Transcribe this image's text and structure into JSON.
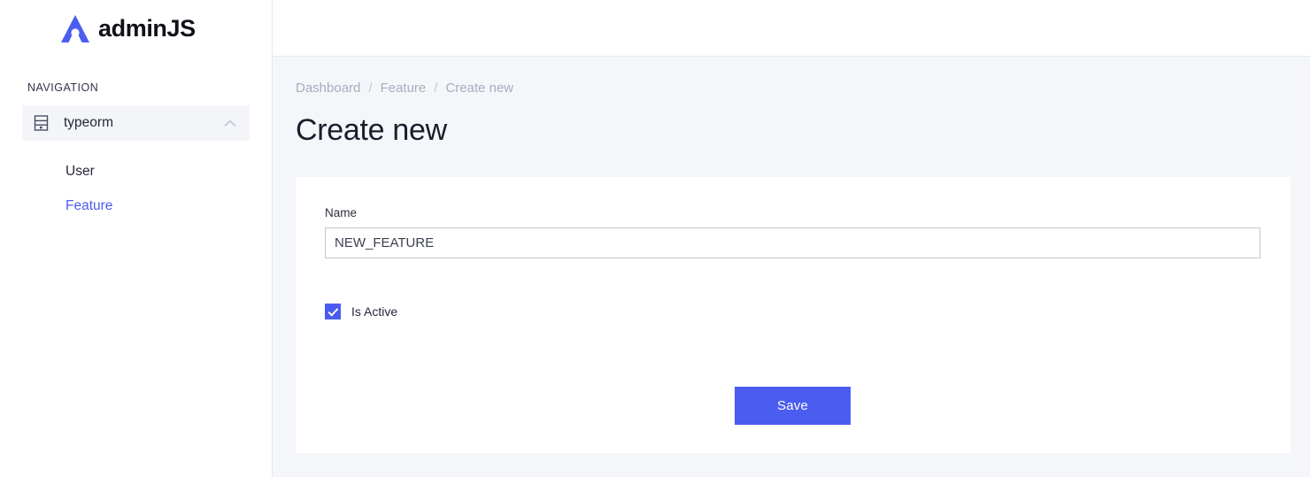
{
  "brand": {
    "logo_icon": "adminjs-a-logo-icon",
    "name": "adminJS",
    "accent_color": "#4b5cf0"
  },
  "sidebar": {
    "nav_title": "NAVIGATION",
    "group": {
      "label": "typeorm",
      "icon": "database-icon",
      "toggle_icon": "chevron-up-icon",
      "expanded": true
    },
    "items": [
      {
        "label": "User",
        "active": false
      },
      {
        "label": "Feature",
        "active": true
      }
    ]
  },
  "breadcrumb": {
    "items": [
      {
        "label": "Dashboard"
      },
      {
        "label": "Feature"
      },
      {
        "label": "Create new"
      }
    ],
    "separator": "/"
  },
  "page": {
    "title": "Create new"
  },
  "form": {
    "name_field": {
      "label": "Name",
      "value": "NEW_FEATURE",
      "placeholder": ""
    },
    "is_active": {
      "label": "Is Active",
      "checked": true,
      "check_icon": "checkmark-icon"
    },
    "save_label": "Save"
  },
  "colors": {
    "accent": "#4b5cf0",
    "page_background": "#f5f6fa",
    "card_background": "#ffffff",
    "muted_text": "#a9acbe"
  }
}
